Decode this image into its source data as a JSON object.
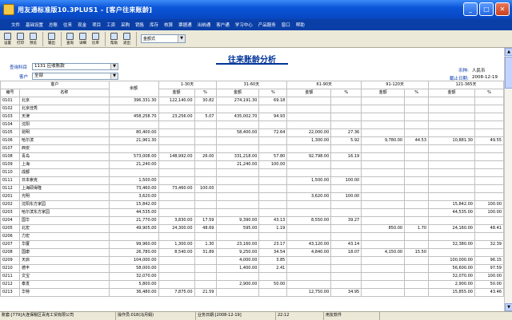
{
  "window": {
    "title": "用友通标准版10.3PLUS1 - [客户往来账龄]"
  },
  "menu": [
    "文件",
    "基础设置",
    "总账",
    "往来",
    "现金",
    "项目",
    "工资",
    "采购",
    "销售",
    "库存",
    "核算",
    "票据通",
    "出纳通",
    "客户通",
    "学习中心",
    "产品服务",
    "窗口",
    "帮助"
  ],
  "toolbar": {
    "buttons": [
      "设置",
      "打印",
      "预览",
      "输出",
      "查询",
      "详细",
      "比率",
      "帮助",
      "退出"
    ],
    "format_select": "金额式"
  },
  "report": {
    "title": "往来账龄分析",
    "subject_label": "查询科目",
    "subject_value": "1131 应收账款",
    "customer_label": "客户",
    "customer_value": "全部",
    "currency_label": "币种:",
    "currency_value": "人民币",
    "date_label": "截止日期:",
    "date_value": "2008-12-19"
  },
  "table": {
    "group_customer": "客户",
    "col_code": "编号",
    "col_name": "名称",
    "col_amount": "余额",
    "periods": [
      "1-30天",
      "31-60天",
      "61-90天",
      "91-120天",
      "121-365天"
    ],
    "sub_amount": "金额",
    "sub_pct": "%",
    "rows": [
      [
        "0101",
        "北京",
        "396,331.30",
        "122,140.00",
        "30.82",
        "274,191.30",
        "69.18",
        "",
        "",
        "",
        "",
        "",
        ""
      ],
      [
        "0102",
        "北京佳秀",
        "",
        "",
        "",
        "",
        "",
        "",
        "",
        "",
        "",
        "",
        ""
      ],
      [
        "0103",
        "天津",
        "458,258.70",
        "23,256.00",
        "5.07",
        "435,002.70",
        "94.93",
        "",
        "",
        "",
        "",
        "",
        ""
      ],
      [
        "0104",
        "沈阳",
        "",
        "",
        "",
        "",
        "",
        "",
        "",
        "",
        "",
        "",
        ""
      ],
      [
        "0105",
        "昆明",
        "80,400.00",
        "",
        "",
        "58,400.00",
        "72.64",
        "22,000.00",
        "27.36",
        "",
        "",
        "",
        ""
      ],
      [
        "0106",
        "哈尔滨",
        "21,961.30",
        "",
        "",
        "",
        "",
        "1,300.00",
        "5.92",
        "9,780.00",
        "44.53",
        "10,881.30",
        "49.55"
      ],
      [
        "0107",
        "西安",
        "",
        "",
        "",
        "",
        "",
        "",
        "",
        "",
        "",
        "",
        ""
      ],
      [
        "0108",
        "青岛",
        "573,008.00",
        "148,992.00",
        "26.00",
        "331,218.00",
        "57.80",
        "92,798.00",
        "16.19",
        "",
        "",
        "",
        ""
      ],
      [
        "0109",
        "上海",
        "21,240.00",
        "",
        "",
        "21,240.00",
        "100.00",
        "",
        "",
        "",
        "",
        "",
        ""
      ],
      [
        "0110",
        "成都",
        "",
        "",
        "",
        "",
        "",
        "",
        "",
        "",
        "",
        "",
        ""
      ],
      [
        "0111",
        "日本索克",
        "1,500.00",
        "",
        "",
        "",
        "",
        "1,500.00",
        "100.00",
        "",
        "",
        "",
        ""
      ],
      [
        "0112",
        "上海硕得隆",
        "73,460.00",
        "73,460.00",
        "100.00",
        "",
        "",
        "",
        "",
        "",
        "",
        "",
        ""
      ],
      [
        "0201",
        "光明",
        "3,620.00",
        "",
        "",
        "",
        "",
        "3,620.00",
        "100.00",
        "",
        "",
        "",
        ""
      ],
      [
        "0202",
        "沈阳东方家园",
        "15,842.00",
        "",
        "",
        "",
        "",
        "",
        "",
        "",
        "",
        "15,842.00",
        "100.00"
      ],
      [
        "0203",
        "哈尔滨东方家园",
        "44,535.00",
        "",
        "",
        "",
        "",
        "",
        "",
        "",
        "",
        "44,535.00",
        "100.00"
      ],
      [
        "0204",
        "国华",
        "21,770.00",
        "3,830.00",
        "17.59",
        "9,390.00",
        "43.13",
        "8,550.00",
        "39.27",
        "",
        "",
        "",
        ""
      ],
      [
        "0205",
        "北宏",
        "49,905.00",
        "24,300.00",
        "48.69",
        "595.00",
        "1.19",
        "",
        "",
        "850.00",
        "1.70",
        "24,160.00",
        "48.41"
      ],
      [
        "0206",
        "力宏",
        "",
        "",
        "",
        "",
        "",
        "",
        "",
        "",
        "",
        "",
        ""
      ],
      [
        "0207",
        "华厦",
        "99,960.00",
        "1,300.00",
        "1.30",
        "23,160.00",
        "23.17",
        "43,120.00",
        "43.14",
        "",
        "",
        "32,380.00",
        "32.39"
      ],
      [
        "0208",
        "国康",
        "26,780.00",
        "8,540.00",
        "31.89",
        "9,250.00",
        "34.54",
        "4,840.00",
        "18.07",
        "4,150.00",
        "15.50",
        "",
        ""
      ],
      [
        "0209",
        "天启",
        "104,000.00",
        "",
        "",
        "4,000.00",
        "3.85",
        "",
        "",
        "",
        "",
        "100,000.00",
        "96.15"
      ],
      [
        "0210",
        "德丰",
        "58,000.00",
        "",
        "",
        "1,400.00",
        "2.41",
        "",
        "",
        "",
        "",
        "56,600.00",
        "97.59"
      ],
      [
        "0211",
        "文宝",
        "32,070.00",
        "",
        "",
        "",
        "",
        "",
        "",
        "",
        "",
        "32,070.00",
        "100.00"
      ],
      [
        "0212",
        "泰发",
        "5,800.00",
        "",
        "",
        "2,900.00",
        "50.00",
        "",
        "",
        "",
        "",
        "2,900.00",
        "50.00"
      ],
      [
        "0213",
        "华特",
        "36,480.00",
        "7,875.00",
        "21.59",
        "",
        "",
        "12,750.00",
        "34.95",
        "",
        "",
        "15,855.00",
        "43.46"
      ]
    ]
  },
  "status": [
    "账套:[779]大连保税区百克工贸有限公司",
    "操作员:018(冯月娟)",
    "业务日期:[2008-12-19]",
    "22:12",
    "用友软件"
  ]
}
